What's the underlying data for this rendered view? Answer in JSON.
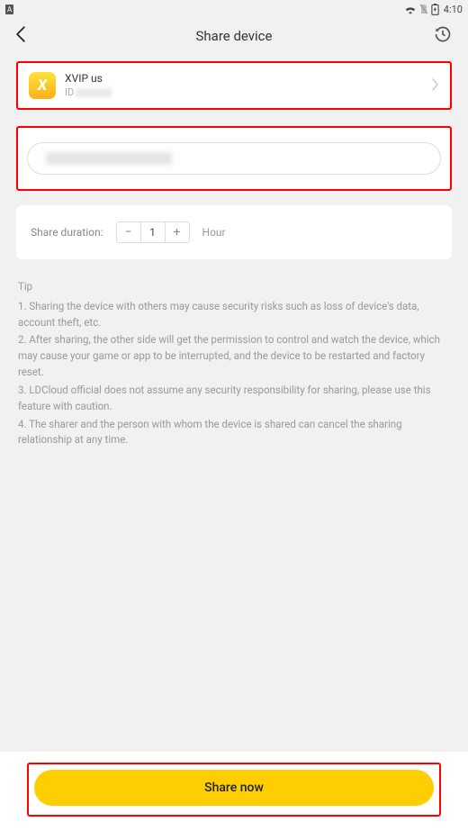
{
  "statusbar": {
    "time": "4:10",
    "app_indicator": "A"
  },
  "header": {
    "title": "Share device"
  },
  "device": {
    "name": "XVIP us",
    "id_label": "ID"
  },
  "duration": {
    "label": "Share duration:",
    "value": "1",
    "unit": "Hour"
  },
  "tips": {
    "title": "Tip",
    "lines": [
      "1. Sharing the device with others may cause security risks such as loss of device's data, account theft, etc.",
      "2. After sharing, the other side will get the permission to control and watch the device, which may cause your game or app to be interrupted, and the device to be restarted and factory reset.",
      "3. LDCloud official does not assume any security responsibility for sharing, please use this feature with caution.",
      "4. The sharer and the person with whom the device is shared can cancel the sharing relationship at any time."
    ]
  },
  "actions": {
    "share_now": "Share now"
  }
}
